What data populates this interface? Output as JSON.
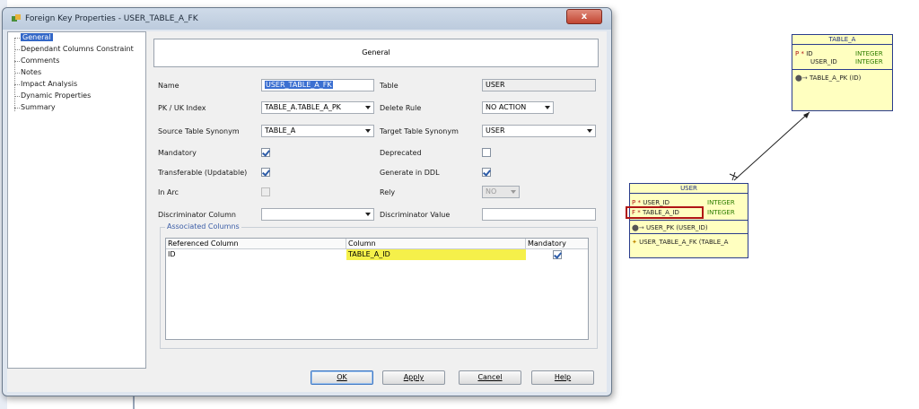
{
  "dialog": {
    "title": "Foreign Key Properties - USER_TABLE_A_FK",
    "close_label": "x"
  },
  "nav": {
    "items": [
      {
        "label": "General"
      },
      {
        "label": "Dependant Columns Constraint"
      },
      {
        "label": "Comments"
      },
      {
        "label": "Notes"
      },
      {
        "label": "Impact Analysis"
      },
      {
        "label": "Dynamic Properties"
      },
      {
        "label": "Summary"
      }
    ]
  },
  "panel": {
    "title": "General"
  },
  "form": {
    "name_label": "Name",
    "name_value": "USER_TABLE_A_FK",
    "table_label": "Table",
    "table_value": "USER",
    "pk_label": "PK / UK Index",
    "pk_value": "TABLE_A.TABLE_A_PK",
    "delete_rule_label": "Delete Rule",
    "delete_rule_value": "NO ACTION",
    "source_syn_label": "Source Table Synonym",
    "source_syn_value": "TABLE_A",
    "target_syn_label": "Target Table Synonym",
    "target_syn_value": "USER",
    "mandatory_label": "Mandatory",
    "deprecated_label": "Deprecated",
    "transferable_label": "Transferable (Updatable)",
    "generate_ddl_label": "Generate in DDL",
    "in_arc_label": "In Arc",
    "rely_label": "Rely",
    "rely_value": "NO",
    "disc_col_label": "Discriminator Column",
    "disc_col_value": "",
    "disc_val_label": "Discriminator Value",
    "disc_val_value": ""
  },
  "assoc": {
    "title": "Associated Columns",
    "headers": [
      "Referenced Column",
      "Column",
      "Mandatory"
    ],
    "rows": [
      {
        "referenced": "ID",
        "column": "TABLE_A_ID",
        "mandatory": true
      }
    ]
  },
  "buttons": {
    "ok": "OK",
    "apply": "Apply",
    "cancel": "Cancel",
    "help": "Help"
  },
  "diagram": {
    "table_a": {
      "title": "TABLE_A",
      "rows": [
        {
          "key": "P",
          "flag": "*",
          "name": "ID",
          "type": "INTEGER"
        },
        {
          "key": "",
          "flag": "",
          "name": "USER_ID",
          "type": "INTEGER"
        }
      ],
      "index": "TABLE_A_PK (ID)"
    },
    "user": {
      "title": "USER",
      "rows": [
        {
          "key": "P",
          "flag": "*",
          "name": "USER_ID",
          "type": "INTEGER"
        },
        {
          "key": "F",
          "flag": "*",
          "name": "TABLE_A_ID",
          "type": "INTEGER"
        }
      ],
      "pk_index": "USER_PK (USER_ID)",
      "fk_index": "USER_TABLE_A_FK (TABLE_A"
    }
  }
}
